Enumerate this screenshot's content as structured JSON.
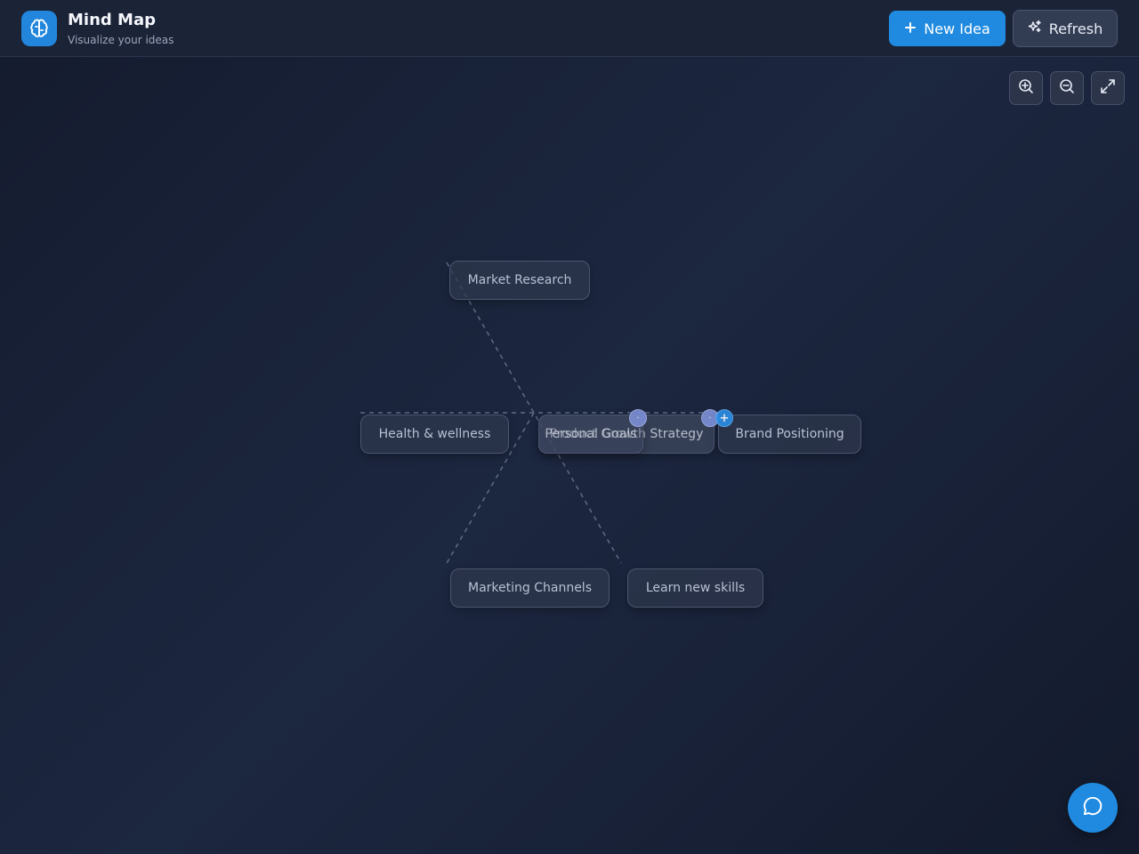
{
  "header": {
    "title": "Mind Map",
    "subtitle": "Visualize your ideas",
    "new_idea_label": "New Idea",
    "refresh_label": "Refresh"
  },
  "toolbar": {
    "zoom_in": "zoom-in-icon",
    "zoom_out": "zoom-out-icon",
    "fullscreen": "expand-icon"
  },
  "nodes": {
    "market_research": "Market Research",
    "health_wellness": "Health & wellness",
    "center_a": "Personal Goals",
    "center_b": "Product Growth Strategy",
    "brand_positioning": "Brand Positioning",
    "marketing_channels": "Marketing Channels",
    "learn_new_skills": "Learn new skills"
  },
  "colors": {
    "accent": "#1f8ae0",
    "background": "#1a2236"
  }
}
